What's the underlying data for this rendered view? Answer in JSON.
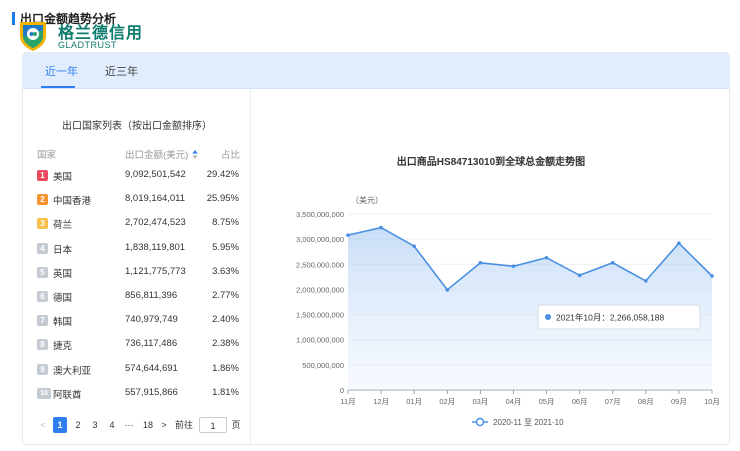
{
  "header": {
    "title": "出口金额趋势分析",
    "logo_cn": "格兰德信用",
    "logo_en": "GLADTRUST"
  },
  "tabs": [
    {
      "label": "近一年",
      "active": true
    },
    {
      "label": "近三年",
      "active": false
    }
  ],
  "list": {
    "title": "出口国家列表（按出口金额排序）",
    "col_country": "国家",
    "col_amount": "出口金额(美元)",
    "col_share": "占比",
    "rows": [
      {
        "rank": "1",
        "country": "美国",
        "amount": "9,092,501,542",
        "share": "29.42%",
        "color": "#e84a5f"
      },
      {
        "rank": "2",
        "country": "中国香港",
        "amount": "8,019,164,011",
        "share": "25.95%",
        "color": "#f59331"
      },
      {
        "rank": "3",
        "country": "荷兰",
        "amount": "2,702,474,523",
        "share": "8.75%",
        "color": "#f7c04a"
      },
      {
        "rank": "4",
        "country": "日本",
        "amount": "1,838,119,801",
        "share": "5.95%",
        "color": "#c5cbd3"
      },
      {
        "rank": "5",
        "country": "英国",
        "amount": "1,121,775,773",
        "share": "3.63%",
        "color": "#c5cbd3"
      },
      {
        "rank": "6",
        "country": "德国",
        "amount": "856,811,396",
        "share": "2.77%",
        "color": "#c5cbd3"
      },
      {
        "rank": "7",
        "country": "韩国",
        "amount": "740,979,749",
        "share": "2.40%",
        "color": "#c5cbd3"
      },
      {
        "rank": "8",
        "country": "捷克",
        "amount": "736,117,486",
        "share": "2.38%",
        "color": "#c5cbd3"
      },
      {
        "rank": "9",
        "country": "澳大利亚",
        "amount": "574,644,691",
        "share": "1.86%",
        "color": "#c5cbd3"
      },
      {
        "rank": "10",
        "country": "阿联酋",
        "amount": "557,915,866",
        "share": "1.81%",
        "color": "#c5cbd3"
      }
    ]
  },
  "pager": {
    "prev": "<",
    "pages": [
      "1",
      "2",
      "3",
      "4"
    ],
    "ellipsis": "···",
    "last": "18",
    "next": ">",
    "goto_label": "前往",
    "goto_value": "1",
    "page_unit": "页"
  },
  "chart_data": {
    "type": "line",
    "title": "出口商品HS84713010到全球总金额走势图",
    "ylabel": "（美元）",
    "xlabel": "",
    "categories": [
      "11月",
      "12月",
      "01月",
      "02月",
      "03月",
      "04月",
      "05月",
      "06月",
      "07月",
      "08月",
      "09月",
      "10月"
    ],
    "series": [
      {
        "name": "2020-11 至 2021-10",
        "values": [
          3080000000,
          3230000000,
          2860000000,
          1990000000,
          2530000000,
          2460000000,
          2630000000,
          2280000000,
          2530000000,
          2170000000,
          2920000000,
          2266058188
        ]
      }
    ],
    "yticks": [
      "0",
      "500,000,000",
      "1,000,000,000",
      "1,500,000,000",
      "2,000,000,000",
      "2,500,000,000",
      "3,000,000,000",
      "3,500,000,000"
    ],
    "ylim": [
      0,
      3500000000
    ],
    "area_fill": true,
    "line_color": "#4a90e2",
    "tooltip": {
      "label": "2021年10月：2,266,058,188",
      "index": 11
    },
    "legend_position": "bottom"
  }
}
